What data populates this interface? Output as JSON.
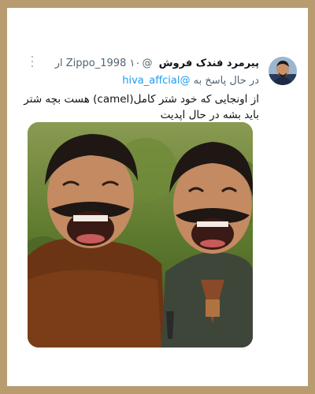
{
  "tweet": {
    "display_name": "پیرمرد فندک فروش",
    "handle": "@Zippo_1998",
    "time": "۱۰ ار",
    "reply_prefix": "در حال پاسخ به",
    "reply_to": "@hiva_affcial",
    "text": "از اونجایی که خود شتر کامل(camel) هست بچه شتر باید بشه در حال اپدیت"
  },
  "icons": {
    "menu": "more-options-icon",
    "avatar": "avatar-photo"
  },
  "colors": {
    "page_background": "#b89c6f",
    "card_background": "#ffffff",
    "link": "#1d9bf0",
    "secondary_text": "#536471"
  }
}
